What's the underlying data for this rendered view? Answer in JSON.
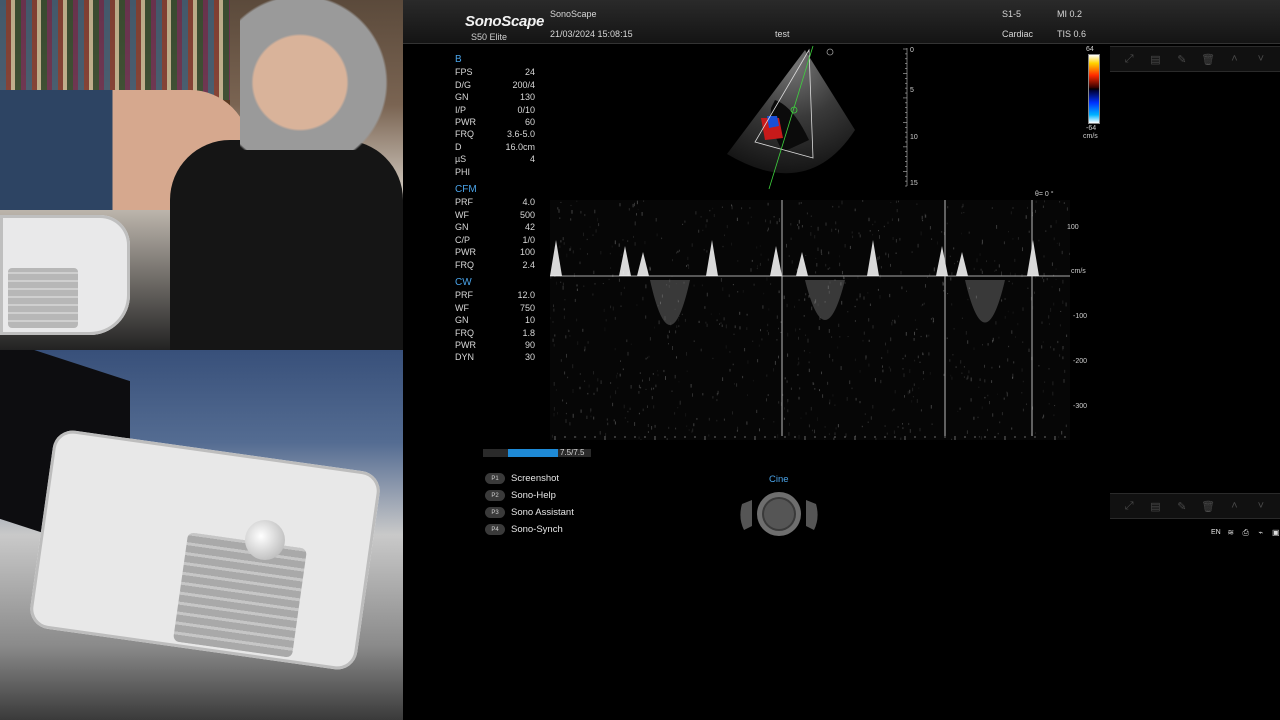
{
  "camera": {
    "top_label": "",
    "bottom_label": ""
  },
  "header": {
    "brand": "SonoScape",
    "model": "S50 Elite",
    "app_name": "SonoScape",
    "datetime": "21/03/2024 15:08:15",
    "patient": "test",
    "probe": "S1-5",
    "exam": "Cardiac",
    "mi": "MI 0.2",
    "tis": "TIS 0.6"
  },
  "params": {
    "b": {
      "title": "B",
      "rows": [
        {
          "k": "FPS",
          "v": "24"
        },
        {
          "k": "D/G",
          "v": "200/4"
        },
        {
          "k": "GN",
          "v": "130"
        },
        {
          "k": "I/P",
          "v": "0/10"
        },
        {
          "k": "PWR",
          "v": "60"
        },
        {
          "k": "FRQ",
          "v": "3.6-5.0"
        },
        {
          "k": "D",
          "v": "16.0cm"
        },
        {
          "k": "µS",
          "v": "4"
        },
        {
          "k": "PHI",
          "v": ""
        }
      ]
    },
    "cfm": {
      "title": "CFM",
      "rows": [
        {
          "k": "PRF",
          "v": "4.0"
        },
        {
          "k": "WF",
          "v": "500"
        },
        {
          "k": "GN",
          "v": "42"
        },
        {
          "k": "C/P",
          "v": "1/0"
        },
        {
          "k": "PWR",
          "v": "100"
        },
        {
          "k": "FRQ",
          "v": "2.4"
        }
      ]
    },
    "cw": {
      "title": "CW",
      "rows": [
        {
          "k": "PRF",
          "v": "12.0"
        },
        {
          "k": "WF",
          "v": "750"
        },
        {
          "k": "GN",
          "v": "10"
        },
        {
          "k": "FRQ",
          "v": "1.8"
        },
        {
          "k": "PWR",
          "v": "90"
        },
        {
          "k": "DYN",
          "v": "30"
        }
      ]
    }
  },
  "depth_scale": [
    "0",
    "5",
    "10",
    "15"
  ],
  "color_bar": {
    "max": "64",
    "min": "-64",
    "unit": "cm/s"
  },
  "spectrum": {
    "angle": "θ= 0 °",
    "ticks": [
      "100",
      "cm/s",
      "-100",
      "-200",
      "-300"
    ],
    "colors": {
      "trace": "#ffffff",
      "baseline": "#dddddd"
    }
  },
  "cine": {
    "progress_label": "7.5/7.5",
    "progress_fraction": 1.0,
    "title": "Cine"
  },
  "presets": [
    {
      "key": "P1",
      "label": "Screenshot"
    },
    {
      "key": "P2",
      "label": "Sono-Help"
    },
    {
      "key": "P3",
      "label": "Sono Assistant"
    },
    {
      "key": "P4",
      "label": "Sono-Synch"
    }
  ],
  "status": {
    "lang": "EN"
  },
  "colors": {
    "accent": "#4aa3e8",
    "cine_bar": "#1e8ad6"
  }
}
